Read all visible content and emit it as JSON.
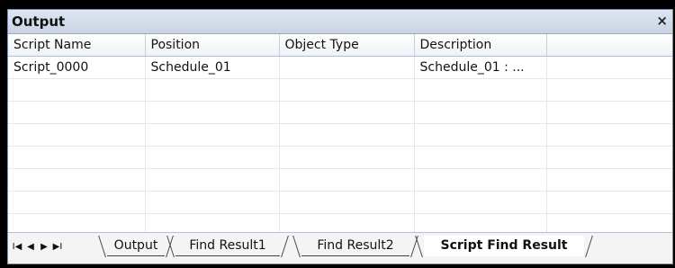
{
  "panel": {
    "title": "Output",
    "close_glyph": "×"
  },
  "grid": {
    "columns": [
      "Script Name",
      "Position",
      "Object Type",
      "Description"
    ],
    "rows": [
      [
        "Script_0000",
        "Schedule_01",
        "",
        "Schedule_01 : ..."
      ]
    ]
  },
  "tabs": {
    "nav": [
      "I◀",
      "◀",
      "▶",
      "▶I"
    ],
    "items": [
      "Output",
      "Find Result1",
      "Find Result2",
      "Script Find Result"
    ],
    "active_index": 3
  }
}
